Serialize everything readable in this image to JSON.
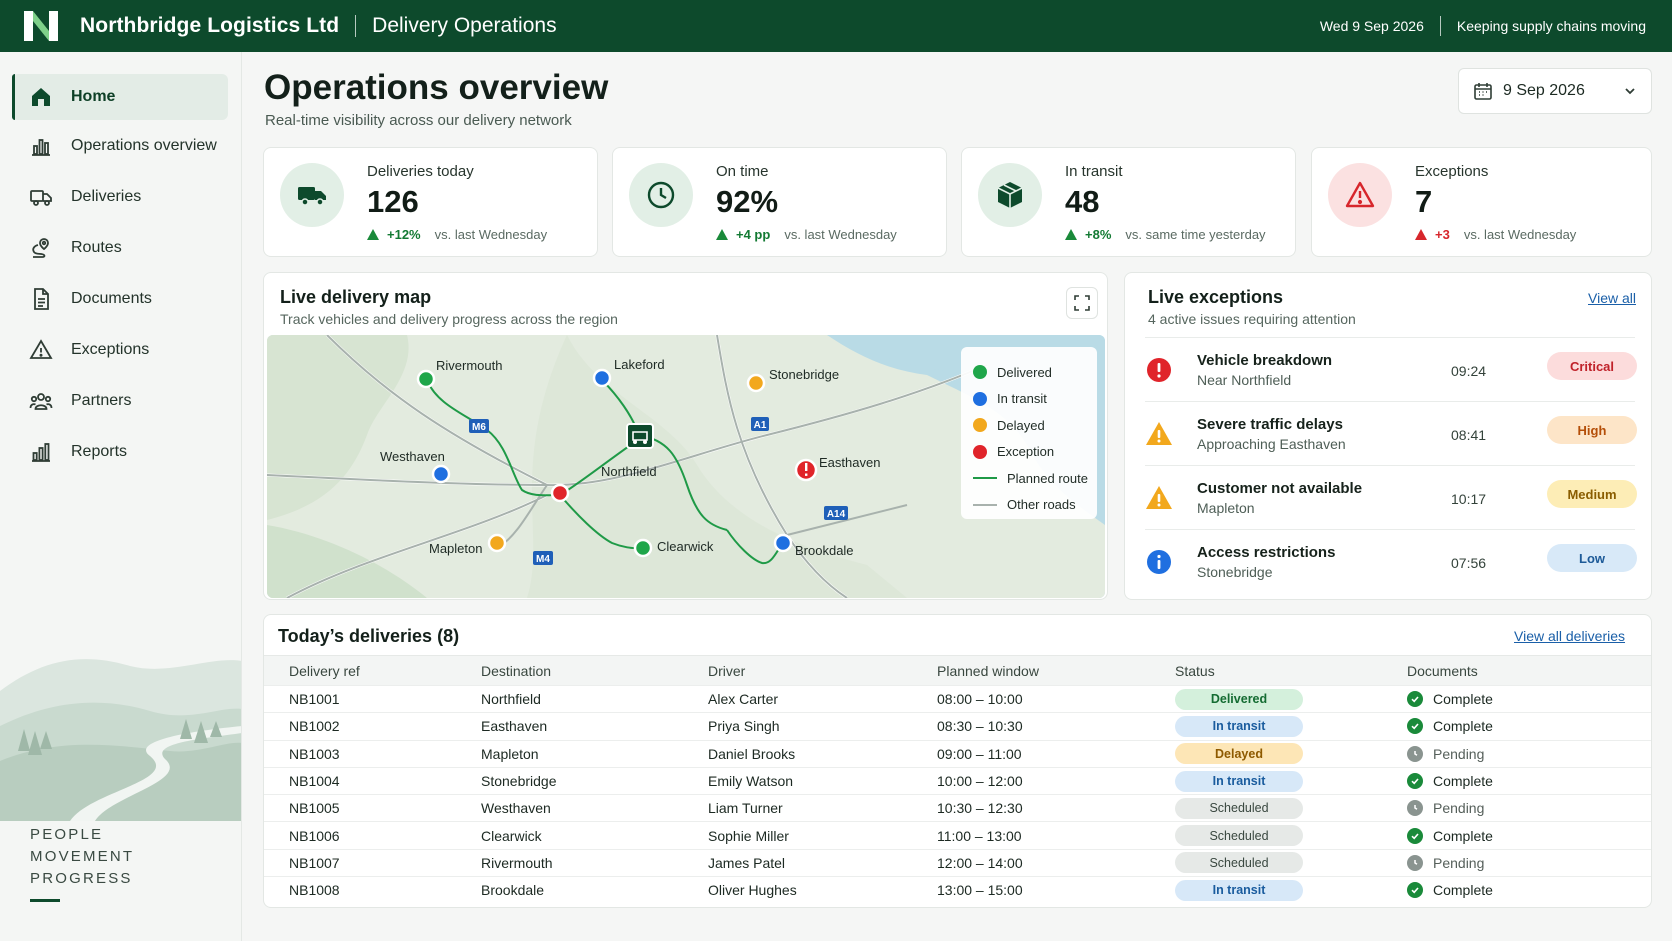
{
  "header": {
    "brand": "Northbridge Logistics Ltd",
    "section": "Delivery Operations",
    "date": "Wed 9 Sep 2026",
    "tagline": "Keeping supply chains moving"
  },
  "sidebar": {
    "items": [
      {
        "label": "Home",
        "icon": "home-icon",
        "active": true
      },
      {
        "label": "Operations overview",
        "icon": "bar-chart-icon"
      },
      {
        "label": "Deliveries",
        "icon": "truck-icon"
      },
      {
        "label": "Routes",
        "icon": "route-pin-icon"
      },
      {
        "label": "Documents",
        "icon": "document-icon"
      },
      {
        "label": "Exceptions",
        "icon": "warning-icon"
      },
      {
        "label": "Partners",
        "icon": "people-icon"
      },
      {
        "label": "Reports",
        "icon": "reports-icon"
      }
    ],
    "motto": [
      "PEOPLE",
      "MOVEMENT",
      "PROGRESS"
    ]
  },
  "page": {
    "title": "Operations overview",
    "subtitle": "Real-time visibility across our delivery network",
    "date_filter": "9 Sep 2026"
  },
  "kpis": [
    {
      "label": "Deliveries today",
      "value": "126",
      "delta": "+12%",
      "note": "vs. last Wednesday",
      "icon": "truck-icon",
      "tone": "green"
    },
    {
      "label": "On time",
      "value": "92%",
      "delta": "+4 pp",
      "note": "vs. last Wednesday",
      "icon": "clock-icon",
      "tone": "green"
    },
    {
      "label": "In transit",
      "value": "48",
      "delta": "+8%",
      "note": "vs. same time yesterday",
      "icon": "package-icon",
      "tone": "green"
    },
    {
      "label": "Exceptions",
      "value": "7",
      "delta": "+3",
      "note": "vs. last Wednesday",
      "icon": "alert-triangle-icon",
      "tone": "red"
    }
  ],
  "map": {
    "title": "Live delivery map",
    "subtitle": "Track vehicles and delivery progress across the region",
    "places": [
      "Rivermouth",
      "Lakeford",
      "Stonebridge",
      "Westhaven",
      "Northfield",
      "Easthaven",
      "Mapleton",
      "Clearwick",
      "Brookdale"
    ],
    "roads": [
      "M6",
      "A1",
      "A14",
      "M4"
    ],
    "legend": [
      "Delivered",
      "In transit",
      "Delayed",
      "Exception",
      "Planned route",
      "Other roads"
    ],
    "colors": {
      "delivered": "#1fa64a",
      "in_transit": "#1f6fe0",
      "delayed": "#f2a81d",
      "exception": "#e0242a",
      "route": "#1f9a47",
      "road": "#a8b2ad"
    }
  },
  "exceptions": {
    "title": "Live exceptions",
    "subtitle": "4 active issues requiring attention",
    "view_all": "View all",
    "items": [
      {
        "title": "Vehicle breakdown",
        "location": "Near Northfield",
        "time": "09:24",
        "severity": "Critical",
        "icon": "error-circle-icon"
      },
      {
        "title": "Severe traffic delays",
        "location": "Approaching Easthaven",
        "time": "08:41",
        "severity": "High",
        "icon": "warning-icon"
      },
      {
        "title": "Customer not available",
        "location": "Mapleton",
        "time": "10:17",
        "severity": "Medium",
        "icon": "warning-icon"
      },
      {
        "title": "Access restrictions",
        "location": "Stonebridge",
        "time": "07:56",
        "severity": "Low",
        "icon": "info-icon"
      }
    ]
  },
  "deliveries": {
    "title": "Today’s deliveries (8)",
    "view_all": "View all deliveries",
    "columns": [
      "Delivery ref",
      "Destination",
      "Driver",
      "Planned window",
      "Status",
      "Documents"
    ],
    "rows": [
      {
        "ref": "NB1001",
        "destination": "Northfield",
        "driver": "Alex Carter",
        "window": "08:00 – 10:00",
        "status": "Delivered",
        "documents": "Complete"
      },
      {
        "ref": "NB1002",
        "destination": "Easthaven",
        "driver": "Priya Singh",
        "window": "08:30 – 10:30",
        "status": "In transit",
        "documents": "Complete"
      },
      {
        "ref": "NB1003",
        "destination": "Mapleton",
        "driver": "Daniel Brooks",
        "window": "09:00 – 11:00",
        "status": "Delayed",
        "documents": "Pending"
      },
      {
        "ref": "NB1004",
        "destination": "Stonebridge",
        "driver": "Emily Watson",
        "window": "10:00 – 12:00",
        "status": "In transit",
        "documents": "Complete"
      },
      {
        "ref": "NB1005",
        "destination": "Westhaven",
        "driver": "Liam Turner",
        "window": "10:30 – 12:30",
        "status": "Scheduled",
        "documents": "Pending"
      },
      {
        "ref": "NB1006",
        "destination": "Clearwick",
        "driver": "Sophie Miller",
        "window": "11:00 – 13:00",
        "status": "Scheduled",
        "documents": "Complete"
      },
      {
        "ref": "NB1007",
        "destination": "Rivermouth",
        "driver": "James Patel",
        "window": "12:00 – 14:00",
        "status": "Scheduled",
        "documents": "Pending"
      },
      {
        "ref": "NB1008",
        "destination": "Brookdale",
        "driver": "Oliver Hughes",
        "window": "13:00 – 15:00",
        "status": "In transit",
        "documents": "Complete"
      }
    ]
  }
}
